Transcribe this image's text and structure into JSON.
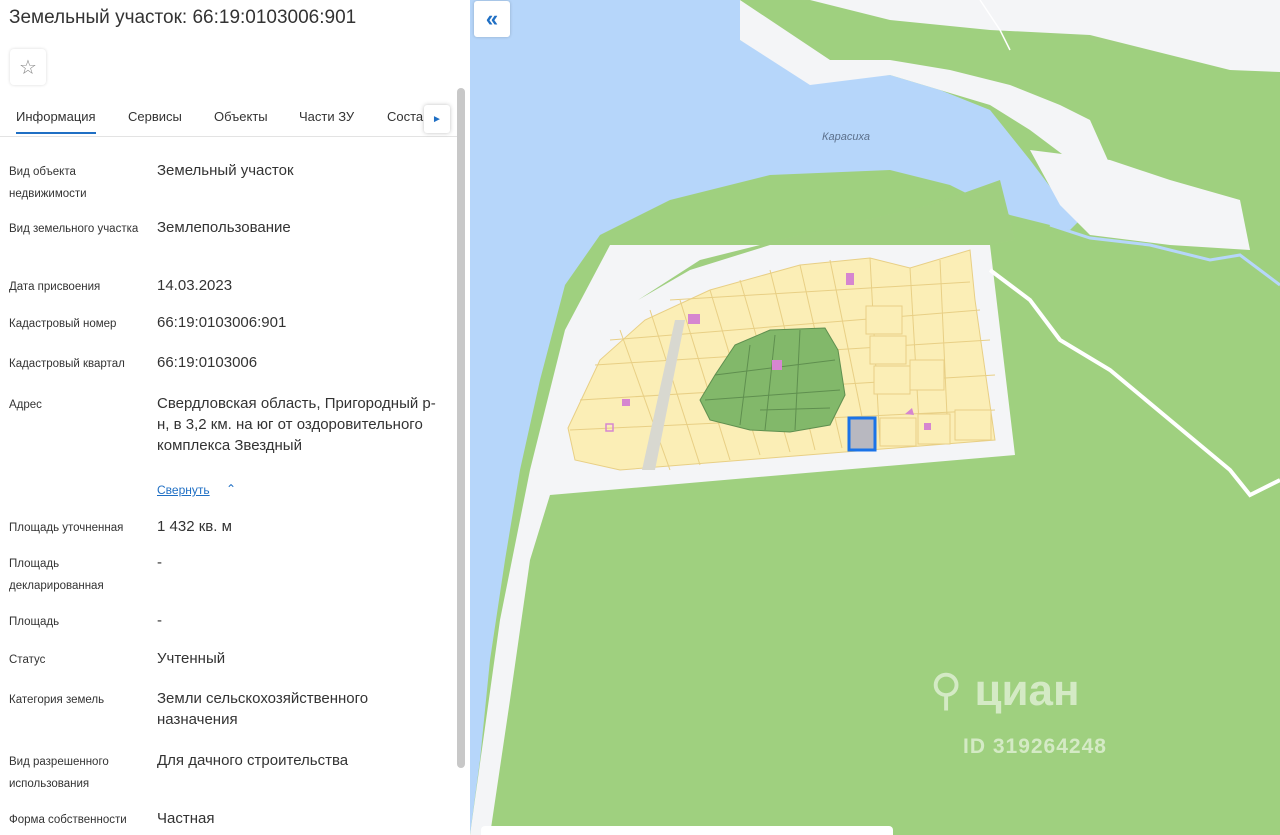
{
  "panel": {
    "title": "Земельный участок: 66:19:0103006:901",
    "favorite_icon": "star-outline-icon",
    "tabs": [
      "Информация",
      "Сервисы",
      "Объекты",
      "Части ЗУ",
      "Соста"
    ],
    "tab_scroll_icon": "chevron-right-icon",
    "fields": [
      {
        "label": "Вид объекта недвижимости",
        "value": "Земельный участок"
      },
      {
        "label": "Вид земельного участка",
        "value": "Землепользование"
      },
      {
        "label": "Дата присвоения",
        "value": "14.03.2023"
      },
      {
        "label": "Кадастровый номер",
        "value": "66:19:0103006:901"
      },
      {
        "label": "Кадастровый квартал",
        "value": "66:19:0103006"
      },
      {
        "label": "Адрес",
        "value": "Свердловская область, Пригородный р-н, в 3,2 км. на юг от оздоровительного комплекса Звездный"
      },
      {
        "label": "Площадь уточненная",
        "value": "1 432 кв. м"
      },
      {
        "label": "Площадь декларированная",
        "value": "-"
      },
      {
        "label": "Площадь",
        "value": "-"
      },
      {
        "label": "Статус",
        "value": "Учтенный"
      },
      {
        "label": "Категория земель",
        "value": "Земли сельскохозяйственного назначения"
      },
      {
        "label": "Вид разрешенного использования",
        "value": "Для дачного строительства"
      },
      {
        "label": "Форма собственности",
        "value": "Частная"
      }
    ],
    "collapse_link": "Свернуть"
  },
  "map": {
    "river_label": "Карасиха",
    "collapse_icon": "double-chevron-left-icon",
    "watermark_logo": "циан",
    "watermark_id": "ID 319264248",
    "colors": {
      "water": "#b6d6fa",
      "forest": "#a0cf80",
      "clearing": "#f2f4f7",
      "parcel": "#fbeeb6",
      "selected_parcel": "#1a73e8"
    }
  }
}
